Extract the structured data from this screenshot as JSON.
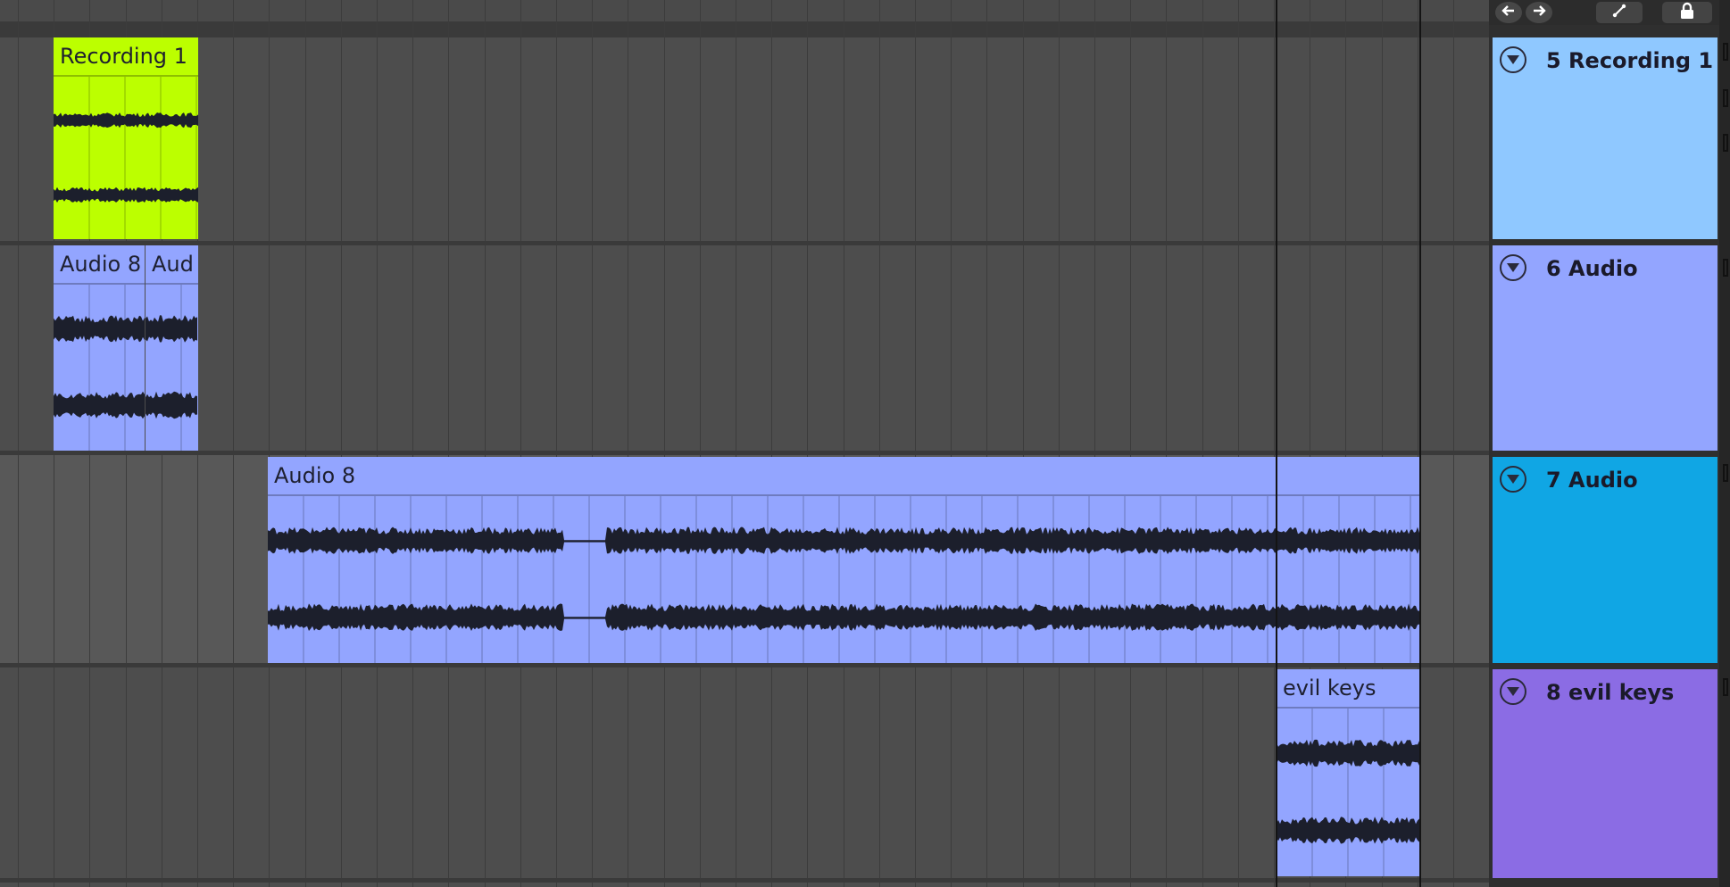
{
  "toolbar": {
    "back_icon": "arrow-left-icon",
    "forward_icon": "arrow-right-icon",
    "automation_icon": "automation-curve-icon",
    "lock_icon": "lock-icon"
  },
  "tracks": [
    {
      "number_name": "5 Recording 1",
      "color": "#8fc8ff",
      "clips": [
        {
          "name": "Recording 1",
          "color": "#bcff00"
        }
      ]
    },
    {
      "number_name": "6 Audio",
      "color": "#93a5ff",
      "clips": [
        {
          "name": "Audio 8",
          "color": "#93a5ff"
        },
        {
          "name": "Aud",
          "color": "#93a5ff"
        }
      ]
    },
    {
      "number_name": "7 Audio",
      "color": "#10a6e4",
      "clips": [
        {
          "name": "Audio 8",
          "color": "#93a5ff"
        }
      ]
    },
    {
      "number_name": "8 evil keys",
      "color": "#8b6ce4",
      "clips": [
        {
          "name": "evil keys",
          "color": "#93a5ff"
        }
      ]
    }
  ],
  "colors": {
    "lane": "#4d4d4d",
    "grid": "#3c3c3c",
    "waveform": "#1c1f2c",
    "divider": "#3a3a3a"
  }
}
